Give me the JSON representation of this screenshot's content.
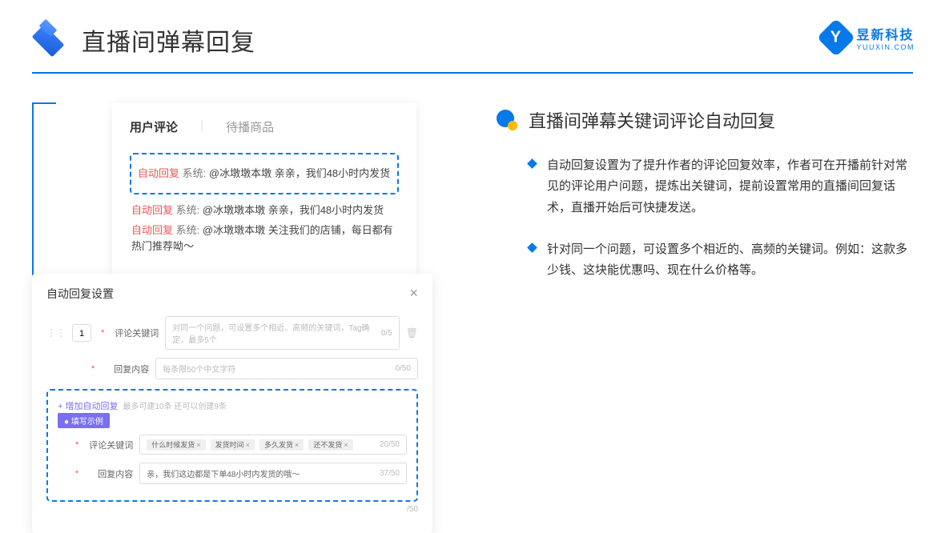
{
  "header": {
    "title": "直播间弹幕回复"
  },
  "brand": {
    "initial": "Y",
    "name": "昱新科技",
    "url": "YUUXIN.COM"
  },
  "card1": {
    "tab1": "用户评论",
    "tab2": "待播商品",
    "c1_tag": "自动回复",
    "c1_sys": "系统:",
    "c1_txt": "@冰墩墩本墩 亲亲，我们48小时内发货",
    "c2_tag": "自动回复",
    "c2_sys": "系统:",
    "c2_txt": "@冰墩墩本墩 亲亲，我们48小时内发货",
    "c3_tag": "自动回复",
    "c3_sys": "系统:",
    "c3_txt": "@冰墩墩本墩 关注我们的店铺，每日都有热门推荐呦～"
  },
  "card2": {
    "title": "自动回复设置",
    "num": "1",
    "label_kw": "评论关键词",
    "ph_kw": "对同一个问题，可设置多个相近、高频的关键词，Tag确定，最多5个",
    "count_kw": "0/5",
    "label_content": "回复内容",
    "ph_content": "每条限50个中文字符",
    "count_content": "0/50",
    "add_link": "+ 增加自动回复",
    "add_hint": "最多可建10条 还可以创建9条",
    "example_badge": "● 填写示例",
    "ex_label_kw": "评论关键词",
    "ex_tag1": "什么时候发货",
    "ex_tag2": "发货时间",
    "ex_tag3": "多久发货",
    "ex_tag4": "还不发货",
    "ex_count_kw": "20/50",
    "ex_label_content": "回复内容",
    "ex_content": "亲，我们这边都是下单48小时内发货的哦～",
    "ex_count_content": "37/50",
    "outer_count": "/50"
  },
  "section": {
    "title": "直播间弹幕关键词评论自动回复",
    "b1": "自动回复设置为了提升作者的评论回复效率，作者可在开播前针对常见的评论用户问题，提炼出关键词，提前设置常用的直播间回复话术，直播开始后可快捷发送。",
    "b2": "针对同一个问题，可设置多个相近的、高频的关键词。例如：这款多少钱、这块能优惠吗、现在什么价格等。"
  }
}
